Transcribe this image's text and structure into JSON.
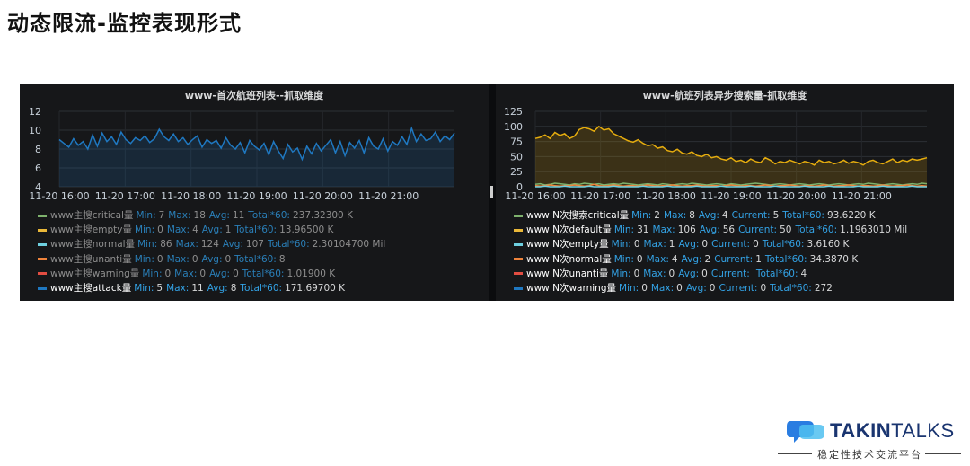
{
  "slide": {
    "title": "动态限流-监控表现形式"
  },
  "colors": {
    "panel_bg": "#161719",
    "accent_blue": "#33a2e5",
    "series_blue": "#1f78c1",
    "series_yellow": "#e5ac0e"
  },
  "panels": [
    {
      "title": "www-首次航班列表--抓取维度",
      "legend": [
        {
          "name": "www主搜critical量",
          "color": "#7eb26d",
          "dim": true,
          "stats": [
            {
              "k": "Min:",
              "v": "7"
            },
            {
              "k": "Max:",
              "v": "18"
            },
            {
              "k": "Avg:",
              "v": "11"
            },
            {
              "k": "Total*60:",
              "v": "237.32300 K"
            }
          ]
        },
        {
          "name": "www主搜empty量",
          "color": "#eab839",
          "dim": true,
          "stats": [
            {
              "k": "Min:",
              "v": "0"
            },
            {
              "k": "Max:",
              "v": "4"
            },
            {
              "k": "Avg:",
              "v": "1"
            },
            {
              "k": "Total*60:",
              "v": "13.96500 K"
            }
          ]
        },
        {
          "name": "www主搜normal量",
          "color": "#6ed0e0",
          "dim": true,
          "stats": [
            {
              "k": "Min:",
              "v": "86"
            },
            {
              "k": "Max:",
              "v": "124"
            },
            {
              "k": "Avg:",
              "v": "107"
            },
            {
              "k": "Total*60:",
              "v": "2.30104700 Mil"
            }
          ]
        },
        {
          "name": "www主搜unanti量",
          "color": "#ef843c",
          "dim": true,
          "stats": [
            {
              "k": "Min:",
              "v": "0"
            },
            {
              "k": "Max:",
              "v": "0"
            },
            {
              "k": "Avg:",
              "v": "0"
            },
            {
              "k": "Total*60:",
              "v": "8"
            }
          ]
        },
        {
          "name": "www主搜warning量",
          "color": "#e24d42",
          "dim": true,
          "stats": [
            {
              "k": "Min:",
              "v": "0"
            },
            {
              "k": "Max:",
              "v": "0"
            },
            {
              "k": "Avg:",
              "v": "0"
            },
            {
              "k": "Total*60:",
              "v": "1.01900 K"
            }
          ]
        },
        {
          "name": "www主搜attack量",
          "color": "#1f78c1",
          "dim": false,
          "stats": [
            {
              "k": "Min:",
              "v": "5"
            },
            {
              "k": "Max:",
              "v": "11"
            },
            {
              "k": "Avg:",
              "v": "8"
            },
            {
              "k": "Total*60:",
              "v": "171.69700 K"
            }
          ]
        }
      ]
    },
    {
      "title": "www-航班列表异步搜索量-抓取维度",
      "legend": [
        {
          "name": "www N次搜索critical量",
          "color": "#7eb26d",
          "dim": false,
          "stats": [
            {
              "k": "Min:",
              "v": "2"
            },
            {
              "k": "Max:",
              "v": "8"
            },
            {
              "k": "Avg:",
              "v": "4"
            },
            {
              "k": "Current:",
              "v": "5"
            },
            {
              "k": "Total*60:",
              "v": "93.6220 K"
            }
          ]
        },
        {
          "name": "www N次default量",
          "color": "#eab839",
          "dim": false,
          "stats": [
            {
              "k": "Min:",
              "v": "31"
            },
            {
              "k": "Max:",
              "v": "106"
            },
            {
              "k": "Avg:",
              "v": "56"
            },
            {
              "k": "Current:",
              "v": "50"
            },
            {
              "k": "Total*60:",
              "v": "1.1963010 Mil"
            }
          ]
        },
        {
          "name": "www N次empty量",
          "color": "#6ed0e0",
          "dim": false,
          "stats": [
            {
              "k": "Min:",
              "v": "0"
            },
            {
              "k": "Max:",
              "v": "1"
            },
            {
              "k": "Avg:",
              "v": "0"
            },
            {
              "k": "Current:",
              "v": "0"
            },
            {
              "k": "Total*60:",
              "v": "3.6160 K"
            }
          ]
        },
        {
          "name": "www N次normal量",
          "color": "#ef843c",
          "dim": false,
          "stats": [
            {
              "k": "Min:",
              "v": "0"
            },
            {
              "k": "Max:",
              "v": "4"
            },
            {
              "k": "Avg:",
              "v": "2"
            },
            {
              "k": "Current:",
              "v": "1"
            },
            {
              "k": "Total*60:",
              "v": "34.3870 K"
            }
          ]
        },
        {
          "name": "www N次unanti量",
          "color": "#e24d42",
          "dim": false,
          "stats": [
            {
              "k": "Min:",
              "v": "0"
            },
            {
              "k": "Max:",
              "v": "0"
            },
            {
              "k": "Avg:",
              "v": "0"
            },
            {
              "k": "Current:",
              "v": ""
            },
            {
              "k": "Total*60:",
              "v": "4"
            }
          ]
        },
        {
          "name": "www N次warning量",
          "color": "#1f78c1",
          "dim": false,
          "stats": [
            {
              "k": "Min:",
              "v": "0"
            },
            {
              "k": "Max:",
              "v": "0"
            },
            {
              "k": "Avg:",
              "v": "0"
            },
            {
              "k": "Current:",
              "v": "0"
            },
            {
              "k": "Total*60:",
              "v": "272"
            }
          ]
        }
      ]
    }
  ],
  "chart_data": [
    {
      "type": "line",
      "title": "www-首次航班列表--抓取维度",
      "x_ticks": [
        "11-20 16:00",
        "11-20 17:00",
        "11-20 18:00",
        "11-20 19:00",
        "11-20 20:00",
        "11-20 21:00"
      ],
      "y_ticks": [
        "4",
        "6",
        "8",
        "10",
        "12"
      ],
      "ylim": [
        4,
        12
      ],
      "grid": true,
      "series": [
        {
          "name": "www主搜attack量",
          "color": "#1f78c1",
          "fill": true,
          "values": [
            9,
            8.6,
            8.2,
            9.1,
            8.4,
            8.8,
            8.0,
            9.5,
            8.3,
            9.7,
            8.8,
            9.3,
            8.5,
            9.8,
            9.0,
            8.6,
            9.2,
            8.9,
            9.4,
            8.7,
            9.1,
            10.1,
            9.3,
            8.9,
            9.6,
            8.8,
            9.2,
            8.5,
            9.0,
            9.4,
            8.2,
            9.0,
            8.6,
            8.9,
            8.1,
            9.2,
            8.4,
            8.0,
            8.7,
            7.6,
            8.9,
            8.3,
            7.9,
            8.6,
            7.4,
            8.8,
            7.8,
            7.0,
            8.5,
            7.7,
            8.1,
            6.9,
            8.3,
            7.5,
            8.6,
            7.8,
            8.4,
            9.0,
            7.6,
            8.8,
            7.3,
            8.7,
            8.1,
            8.9,
            7.6,
            9.2,
            8.3,
            8.0,
            9.1,
            7.8,
            8.8,
            8.4,
            9.3,
            8.5,
            10.2,
            8.8,
            9.6,
            8.9,
            9.1,
            9.8,
            8.8,
            9.4,
            9.0,
            9.7
          ]
        }
      ]
    },
    {
      "type": "line",
      "title": "www-航班列表异步搜索量-抓取维度",
      "x_ticks": [
        "11-20 16:00",
        "11-20 17:00",
        "11-20 18:00",
        "11-20 19:00",
        "11-20 20:00",
        "11-20 21:00"
      ],
      "y_ticks": [
        "0",
        "25",
        "50",
        "75",
        "100",
        "125"
      ],
      "ylim": [
        0,
        125
      ],
      "grid": true,
      "series": [
        {
          "name": "www N次default量",
          "color": "#e5ac0e",
          "fill": true,
          "values": [
            80,
            82,
            86,
            80,
            90,
            85,
            88,
            80,
            84,
            95,
            98,
            96,
            92,
            100,
            94,
            96,
            88,
            84,
            80,
            76,
            74,
            78,
            72,
            68,
            70,
            64,
            66,
            60,
            58,
            62,
            56,
            54,
            58,
            52,
            50,
            54,
            48,
            50,
            46,
            44,
            48,
            42,
            44,
            40,
            46,
            42,
            40,
            48,
            44,
            38,
            42,
            40,
            44,
            41,
            38,
            42,
            40,
            36,
            44,
            40,
            42,
            38,
            40,
            44,
            39,
            42,
            40,
            36,
            42,
            44,
            40,
            38,
            42,
            46,
            40,
            44,
            42,
            46,
            44,
            46,
            48
          ]
        },
        {
          "name": "www N次critical量",
          "color": "#7eb26d",
          "fill": false,
          "values": [
            4,
            5,
            3,
            4,
            6,
            5,
            4,
            3,
            5,
            4,
            6,
            5,
            4,
            5,
            3,
            4,
            5,
            4,
            6,
            5,
            4,
            3,
            4,
            5,
            4,
            3,
            5,
            4,
            3,
            4,
            5,
            4,
            6,
            5,
            4,
            3,
            4,
            5,
            4,
            3,
            5,
            4,
            3,
            4,
            5,
            6,
            5,
            4,
            3,
            4,
            5,
            4,
            3,
            4,
            5,
            4,
            3,
            4,
            5,
            4,
            3,
            4,
            5,
            4,
            3,
            4,
            5,
            4,
            6,
            5,
            4,
            3,
            4,
            5,
            4,
            3,
            4,
            5,
            4,
            6,
            5
          ]
        },
        {
          "name": "www N次normal量",
          "color": "#ef843c",
          "fill": false,
          "values": [
            2,
            1,
            2,
            3,
            2,
            1,
            2,
            2,
            3,
            2,
            1,
            2,
            4,
            2,
            1,
            2,
            3,
            2,
            1,
            2,
            2,
            1,
            2,
            3,
            2,
            1,
            2,
            2,
            3,
            2,
            1,
            2,
            2,
            3,
            2,
            1,
            2,
            2,
            1,
            2,
            3,
            2,
            1,
            2,
            2,
            1,
            2,
            3,
            2,
            1,
            2,
            2,
            3,
            2,
            1,
            2,
            2,
            1,
            2,
            3,
            2,
            1,
            2,
            2,
            3,
            2,
            1,
            2,
            2,
            1,
            2,
            3,
            2,
            1,
            2,
            2,
            3,
            2,
            1,
            2,
            1
          ]
        },
        {
          "name": "www N次empty量",
          "color": "#6ed0e0",
          "fill": false,
          "values": [
            0,
            0,
            1,
            0,
            0,
            0,
            1,
            0,
            0,
            0,
            0,
            1,
            0,
            0,
            0,
            0,
            1,
            0,
            0,
            0,
            0,
            0,
            1,
            0,
            0,
            0,
            0,
            1,
            0,
            0,
            0,
            0,
            0,
            1,
            0,
            0,
            0,
            0,
            1,
            0,
            0,
            0,
            0,
            0,
            1,
            0,
            0,
            0,
            0,
            1,
            0,
            0,
            0,
            0,
            0,
            1,
            0,
            0,
            0,
            0,
            1,
            0,
            0,
            0,
            0,
            0,
            1,
            0,
            0,
            0,
            0,
            1,
            0,
            0,
            0,
            0,
            0,
            1,
            0,
            0,
            0
          ]
        }
      ]
    }
  ],
  "logo": {
    "brand_bold": "TAKIN",
    "brand_light": "TALKS",
    "tagline": "稳定性技术交流平台"
  }
}
